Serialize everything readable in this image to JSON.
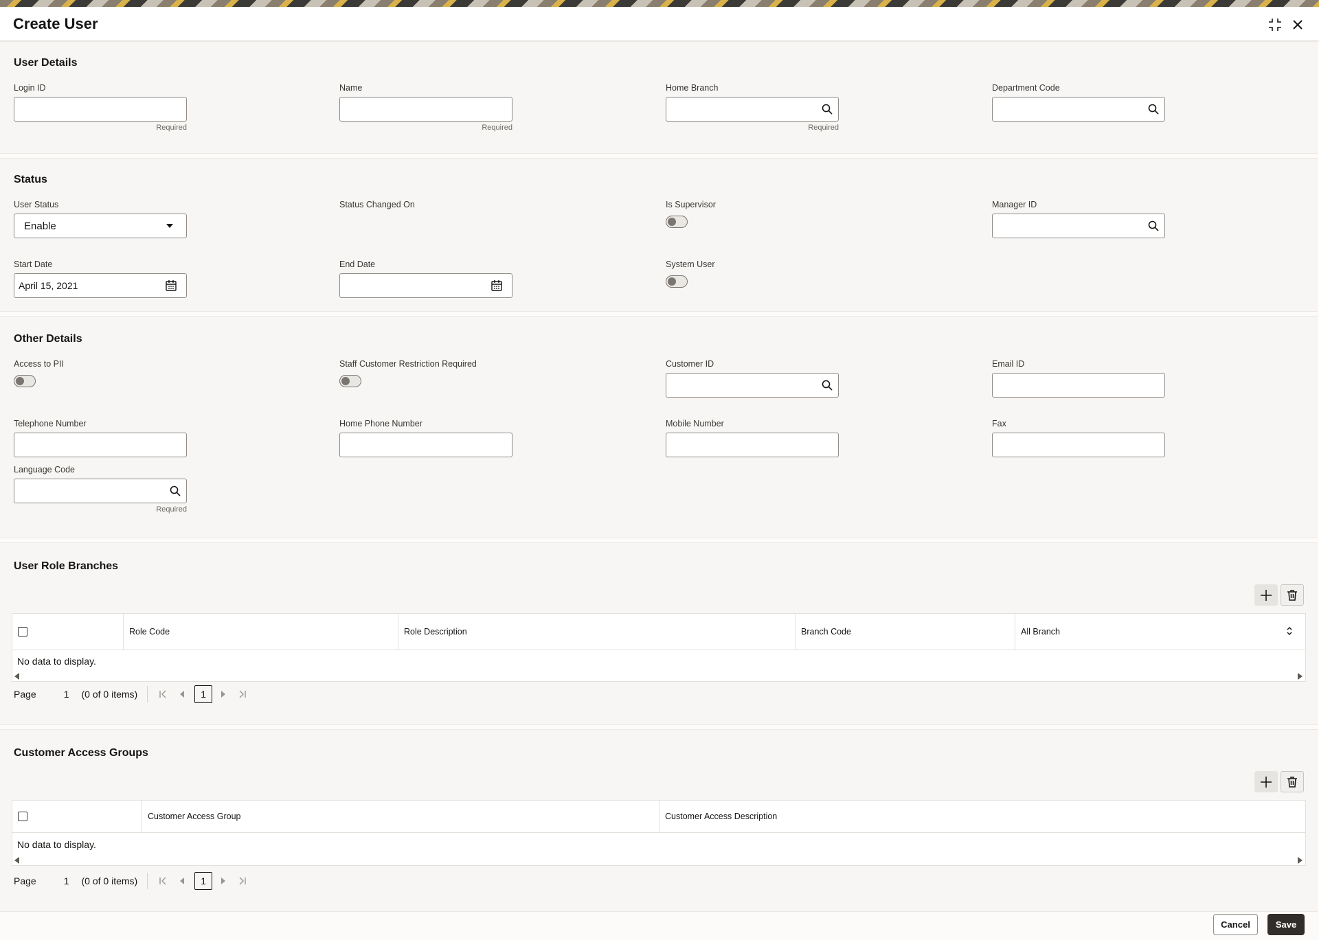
{
  "dialog": {
    "title": "Create User"
  },
  "user_details": {
    "title": "User Details",
    "login_id": {
      "label": "Login ID",
      "value": "",
      "hint": "Required"
    },
    "name": {
      "label": "Name",
      "value": "",
      "hint": "Required"
    },
    "home_branch": {
      "label": "Home Branch",
      "value": "",
      "hint": "Required"
    },
    "department_code": {
      "label": "Department Code",
      "value": ""
    }
  },
  "status": {
    "title": "Status",
    "user_status": {
      "label": "User Status",
      "value": "Enable"
    },
    "status_changed_on": {
      "label": "Status Changed On"
    },
    "is_supervisor": {
      "label": "Is Supervisor",
      "on": false
    },
    "manager_id": {
      "label": "Manager ID",
      "value": ""
    },
    "start_date": {
      "label": "Start Date",
      "value": "April 15, 2021"
    },
    "end_date": {
      "label": "End Date",
      "value": ""
    },
    "system_user": {
      "label": "System User",
      "on": false
    }
  },
  "other_details": {
    "title": "Other Details",
    "access_to_pii": {
      "label": "Access to PII",
      "on": false
    },
    "staff_restriction": {
      "label": "Staff Customer Restriction Required",
      "on": false
    },
    "customer_id": {
      "label": "Customer ID",
      "value": ""
    },
    "email_id": {
      "label": "Email ID",
      "value": ""
    },
    "telephone": {
      "label": "Telephone Number",
      "value": ""
    },
    "home_phone": {
      "label": "Home Phone Number",
      "value": ""
    },
    "mobile": {
      "label": "Mobile Number",
      "value": ""
    },
    "fax": {
      "label": "Fax",
      "value": ""
    },
    "language_code": {
      "label": "Language Code",
      "value": "",
      "hint": "Required"
    }
  },
  "user_role_branches": {
    "title": "User Role Branches",
    "columns": [
      "Role Code",
      "Role Description",
      "Branch Code",
      "All Branch"
    ],
    "empty_text": "No data to display.",
    "pager": {
      "page_label": "Page",
      "page": "1",
      "items": "(0 of 0 items)",
      "current": "1"
    }
  },
  "customer_access_groups": {
    "title": "Customer Access Groups",
    "columns": [
      "Customer Access Group",
      "Customer Access Description"
    ],
    "empty_text": "No data to display.",
    "pager": {
      "page_label": "Page",
      "page": "1",
      "items": "(0 of 0 items)",
      "current": "1"
    }
  },
  "footer": {
    "cancel": "Cancel",
    "save": "Save"
  },
  "icons": [
    "minimize-icon",
    "close-icon",
    "search-icon",
    "dropdown-caret-icon",
    "calendar-icon",
    "plus-icon",
    "trash-icon",
    "sort-icon",
    "first-page-icon",
    "prev-page-icon",
    "next-page-icon",
    "last-page-icon"
  ]
}
